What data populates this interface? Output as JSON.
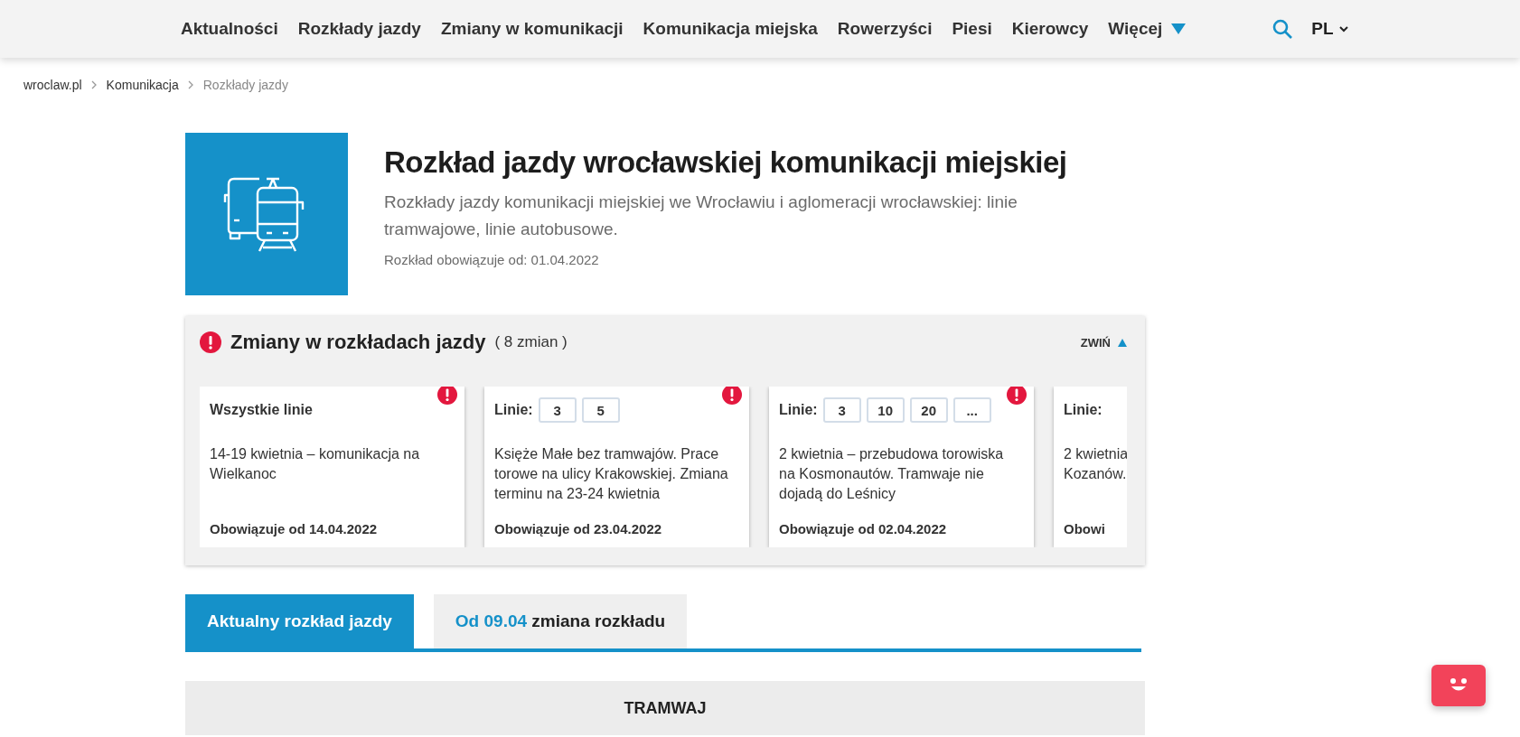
{
  "nav": {
    "items": [
      "Aktualności",
      "Rozkłady jazdy",
      "Zmiany w komunikacji",
      "Komunikacja miejska",
      "Rowerzyści",
      "Piesi",
      "Kierowcy"
    ],
    "more": "Więcej",
    "language": "PL"
  },
  "breadcrumb": [
    {
      "label": "wroclaw.pl",
      "current": false
    },
    {
      "label": "Komunikacja",
      "current": false
    },
    {
      "label": "Rozkłady jazdy",
      "current": true
    }
  ],
  "header": {
    "title": "Rozkład jazdy wrocławskiej komunikacji miejskiej",
    "description": "Rozkłady jazdy komunikacji miejskiej we Wrocławiu i aglomeracji wrocławskiej: linie tramwajowe, linie autobusowe.",
    "valid_from": "Rozkład obowiązuje od: 01.04.2022"
  },
  "changes": {
    "title": "Zmiany w rozkładach jazdy",
    "count": "( 8 zmian )",
    "toggle": "ZWIŃ",
    "expanded": true,
    "cards": [
      {
        "kind": "all",
        "lines_label": "Wszystkie linie",
        "text": "14-19 kwietnia – komunikacja na Wielkanoc",
        "valid": "Obowiązuje od 14.04.2022",
        "alert": true,
        "cut": false
      },
      {
        "kind": "lines",
        "lines_label": "Linie:",
        "lines": [
          "3",
          "5"
        ],
        "text": "Księże Małe bez tramwajów. Prace torowe na ulicy Krakowskiej. Zmiana terminu na 23-24 kwietnia",
        "valid": "Obowiązuje od 23.04.2022",
        "alert": true,
        "cut": false
      },
      {
        "kind": "lines",
        "lines_label": "Linie:",
        "lines": [
          "3",
          "10",
          "20",
          "..."
        ],
        "text": "2 kwietnia – przebudowa torowiska na Kosmonautów. Tramwaje nie dojadą do Leśnicy",
        "valid": "Obowiązuje od 02.04.2022",
        "alert": true,
        "cut": false
      },
      {
        "kind": "lines",
        "lines_label": "Linie:",
        "text_lines": [
          "2 kwietnia",
          "Kozanów."
        ],
        "valid": "Obowi",
        "alert": false,
        "cut": true
      }
    ]
  },
  "tabs": [
    {
      "label": "Aktualny rozkład jazdy",
      "selected": true
    },
    {
      "label": "zmiana rozkładu",
      "highlight": "Od 09.04",
      "selected": false
    }
  ],
  "section": {
    "title": "TRAMWAJ"
  }
}
